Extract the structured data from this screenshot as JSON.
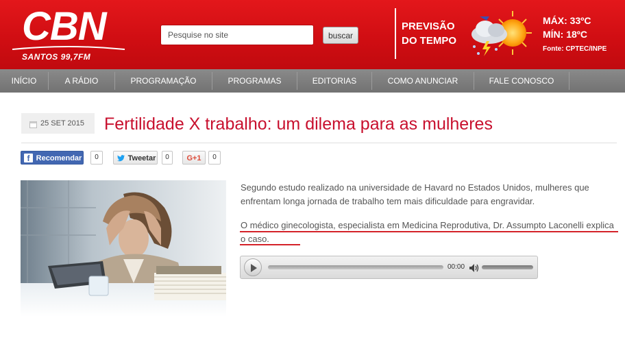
{
  "header": {
    "logo_text": "CBN",
    "logo_sub": "SANTOS 99,7FM",
    "search": {
      "placeholder": "Pesquise no site",
      "button_label": "buscar"
    },
    "weather": {
      "title_line1": "PREVISÃO",
      "title_line2": "DO TEMPO",
      "max": "MÁX: 33ºC",
      "min": "MÍN: 18ºC",
      "source": "Fonte: CPTEC/INPE",
      "icon": "sun-cloud-storm-icon"
    }
  },
  "nav": {
    "items": [
      {
        "label": "INÍCIO"
      },
      {
        "label": "A RÁDIO"
      },
      {
        "label": "PROGRAMAÇÃO"
      },
      {
        "label": "PROGRAMAS"
      },
      {
        "label": "EDITORIAS"
      },
      {
        "label": "COMO ANUNCIAR"
      },
      {
        "label": "FALE CONOSCO"
      }
    ]
  },
  "article": {
    "date": "25 SET 2015",
    "title": "Fertilidade X trabalho: um dilema para as mulheres",
    "share": {
      "facebook_label": "Recomendar",
      "facebook_count": "0",
      "twitter_label": "Tweetar",
      "twitter_count": "0",
      "gplus_label": "G+1",
      "gplus_count": "0"
    },
    "image_alt": "stressed-woman-at-desk-photo",
    "paragraph1": "Segundo estudo realizado na universidade de Havard no Estados Unidos, mulheres que enfrentam longa jornada de trabalho tem mais dificuldade para engravidar.",
    "paragraph2": "O médico ginecologista, especialista em Medicina Reprodutiva, Dr. Assumpto Laconelli explica o caso.",
    "audio": {
      "time": "00:00",
      "progress": 0,
      "volume": 1.0
    }
  },
  "colors": {
    "brand_red": "#d7141a",
    "title_red": "#c8102e",
    "nav_gray": "#7f7f7f",
    "facebook_blue": "#4267b2"
  }
}
